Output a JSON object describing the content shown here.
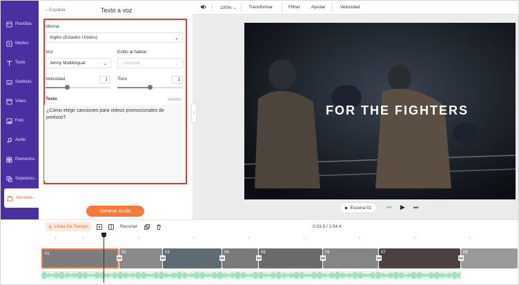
{
  "sidebar": {
    "items": [
      {
        "label": "Plantillas",
        "icon": "templates-icon"
      },
      {
        "label": "Medios",
        "icon": "media-icon"
      },
      {
        "label": "Texto",
        "icon": "text-icon"
      },
      {
        "label": "Subtítulo",
        "icon": "subtitle-icon"
      },
      {
        "label": "Vídeo",
        "icon": "video-icon"
      },
      {
        "label": "Foto",
        "icon": "photo-icon"
      },
      {
        "label": "Audio",
        "icon": "audio-icon"
      },
      {
        "label": "Elementos",
        "icon": "elements-icon"
      },
      {
        "label": "Superposi...",
        "icon": "overlay-icon"
      },
      {
        "label": "Herramie...",
        "icon": "tools-icon"
      }
    ],
    "active_index": 9
  },
  "panel": {
    "back_label": "Espalda",
    "title": "Texto a voz",
    "language_label": "Idioma",
    "language_value": "Inglés (Estados Unidos)",
    "voice_label": "Voz",
    "voice_value": "Jenny Multilingual",
    "style_label": "Estilo al hablar",
    "style_value": "General",
    "speed_label": "Velocidad",
    "speed_value": "1",
    "tone_label": "Tono",
    "tone_value": "1",
    "text_label": "Texto",
    "text_counter": "60/4000",
    "text_value": "¿Cómo elegir canciones para videos promocionales de portivos?",
    "generate_label": "Generar Audio"
  },
  "toolbar": {
    "zoom": "100%",
    "transform": "Transformar",
    "filter": "Filtrar",
    "adjust": "Ajustar",
    "speed": "Velocidad"
  },
  "preview": {
    "overlay_text": "FOR THE FIGHTERS",
    "scene_label": "Escena 01"
  },
  "timeline": {
    "tab_label": "Línea De Tiempo",
    "crop_label": "Recortar",
    "time": "0:03.5 / 1:04.4",
    "clips": [
      "01",
      "02",
      "03",
      "04",
      "05",
      "06",
      "07",
      "08"
    ]
  },
  "colors": {
    "sidebar": "#4a2fa0",
    "accent": "#f47b3b",
    "highlight_box": "#e53935",
    "audio_wave": "#7fdcb0"
  }
}
